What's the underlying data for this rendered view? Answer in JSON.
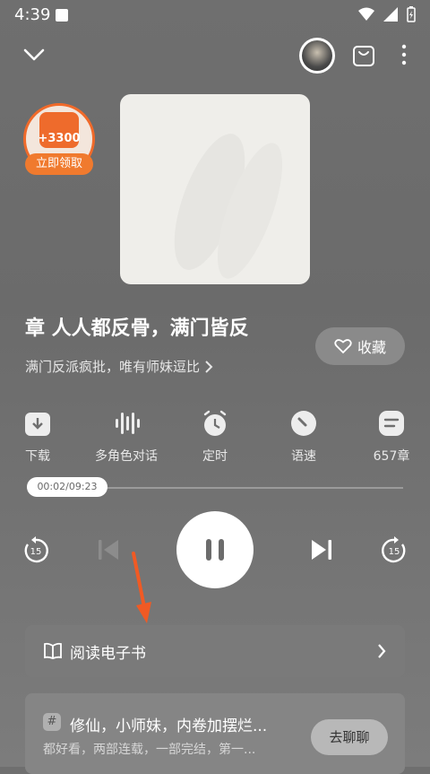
{
  "status_bar": {
    "time": "4:39"
  },
  "header": {
    "icons": [
      "chevron-down-icon",
      "avatar",
      "bag-icon",
      "more-icon"
    ]
  },
  "reward": {
    "amount": "+3300",
    "button_label": "立即领取"
  },
  "book": {
    "title": "章 人人都反骨，满门皆反",
    "subtitle": "满门反派疯批，唯有师妹逗比",
    "favorite_label": "收藏"
  },
  "features": [
    {
      "label": "下载",
      "icon": "download-icon"
    },
    {
      "label": "多角色对话",
      "icon": "voice-icon"
    },
    {
      "label": "定时",
      "icon": "timer-icon"
    },
    {
      "label": "语速",
      "icon": "speed-icon"
    },
    {
      "label": "657章",
      "icon": "chapters-icon"
    }
  ],
  "player": {
    "elapsed": "00:02",
    "duration": "09:23",
    "time_display": "00:02/09:23",
    "progress": 0.0036,
    "skip_back_seconds": "15",
    "skip_forward_seconds": "15",
    "state": "playing"
  },
  "ebook": {
    "label": "阅读电子书"
  },
  "topic": {
    "hash": "#",
    "title": "修仙，小师妹，内卷加摆烂...",
    "desc": "都好看，两部连载，一部完结，第一...",
    "chat_label": "去聊聊"
  },
  "colors": {
    "accent": "#f07a2e",
    "background": "#6f6f6f",
    "arrow": "#f05a24"
  }
}
